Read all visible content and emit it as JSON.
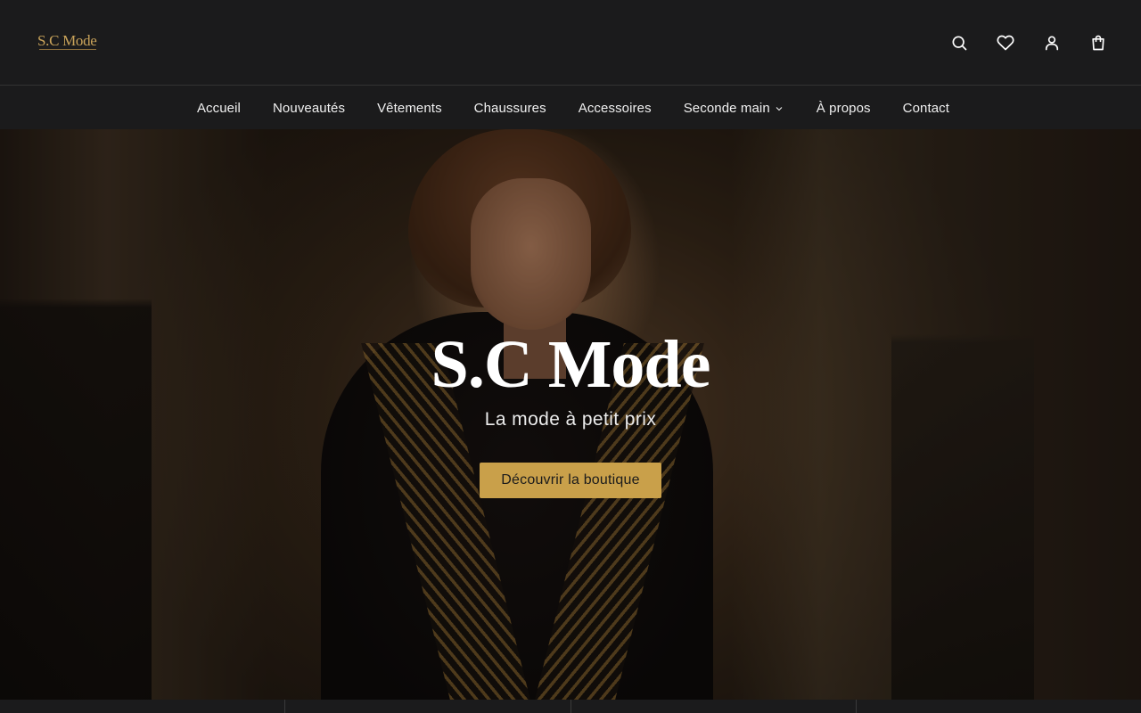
{
  "brand": {
    "logo_text": "S.C Mode",
    "accent_color": "#c9a04a",
    "background_color": "#1b1b1c"
  },
  "header": {
    "icons": [
      "search-icon",
      "heart-icon",
      "user-icon",
      "shopping-bag-icon"
    ]
  },
  "nav": {
    "items": [
      {
        "label": "Accueil"
      },
      {
        "label": "Nouveautés"
      },
      {
        "label": "Vêtements"
      },
      {
        "label": "Chaussures"
      },
      {
        "label": "Accessoires"
      },
      {
        "label": "Seconde main",
        "has_dropdown": true
      },
      {
        "label": "À propos"
      },
      {
        "label": "Contact"
      }
    ]
  },
  "hero": {
    "title": "S.C Mode",
    "subtitle": "La mode à petit prix",
    "cta_label": "Découvrir la boutique"
  }
}
